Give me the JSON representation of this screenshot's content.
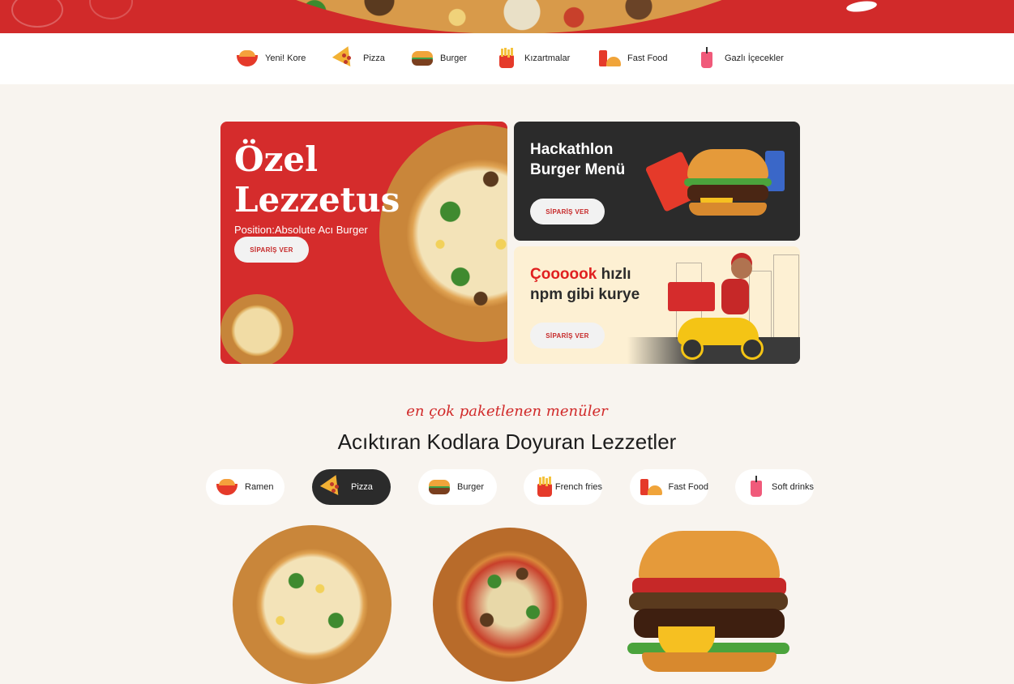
{
  "categories": [
    {
      "label": "Yeni! Kore",
      "icon": "ramen-bowl-icon"
    },
    {
      "label": "Pizza",
      "icon": "pizza-slice-icon"
    },
    {
      "label": "Burger",
      "icon": "burger-icon"
    },
    {
      "label": "Kızartmalar",
      "icon": "fries-icon"
    },
    {
      "label": "Fast Food",
      "icon": "fast-food-icon"
    },
    {
      "label": "Gazlı İçecekler",
      "icon": "soft-drink-icon"
    }
  ],
  "promos": {
    "main": {
      "title_line1": "Özel",
      "title_line2": "Lezzetus",
      "subtitle": "Position:Absolute Acı Burger",
      "button": "SİPARİŞ VER"
    },
    "burger": {
      "title_line1": "Hackathlon",
      "title_line2": "Burger Menü",
      "button": "SİPARİŞ VER"
    },
    "courier": {
      "title_highlight": "Çoooook",
      "title_rest1": " hızlı",
      "title_line2": "npm gibi kurye",
      "button": "SİPARİŞ VER"
    }
  },
  "section": {
    "script_subtitle": "en çok paketlenen menüler",
    "title": "Acıktıran Kodlara Doyuran Lezzetler"
  },
  "tabs": [
    {
      "label": "Ramen",
      "icon": "ramen-bowl-icon",
      "active": false
    },
    {
      "label": "Pizza",
      "icon": "pizza-slice-icon",
      "active": true
    },
    {
      "label": "Burger",
      "icon": "burger-icon",
      "active": false
    },
    {
      "label": "French fries",
      "icon": "fries-icon",
      "active": false
    },
    {
      "label": "Fast Food",
      "icon": "fast-food-icon",
      "active": false
    },
    {
      "label": "Soft drinks",
      "icon": "soft-drink-icon",
      "active": false
    }
  ],
  "colors": {
    "accent_red": "#d12a2a",
    "dark": "#2b2b2b",
    "background": "#f8f4ef",
    "courier_bg": "#fdf0d3"
  }
}
